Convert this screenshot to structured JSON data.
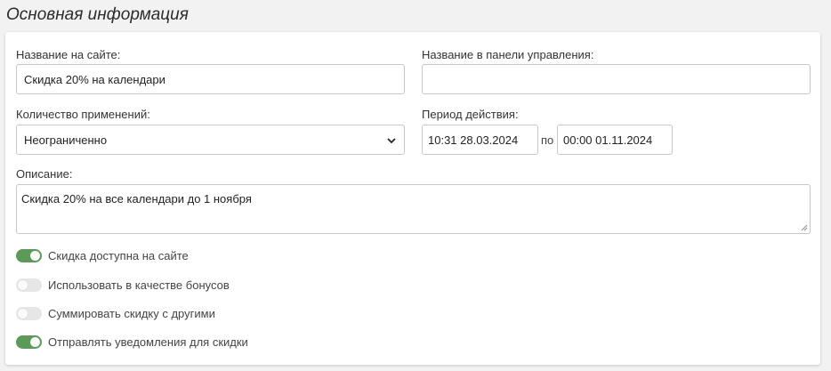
{
  "section_title": "Основная информация",
  "fields": {
    "site_name": {
      "label": "Название на сайте:",
      "value": "Скидка 20% на календари"
    },
    "admin_name": {
      "label": "Название в панели управления:",
      "value": ""
    },
    "usage_count": {
      "label": "Количество применений:",
      "selected": "Неограниченно"
    },
    "period": {
      "label": "Период действия:",
      "from": "10:31 28.03.2024",
      "separator": "по",
      "to": "00:00 01.11.2024"
    },
    "description": {
      "label": "Описание:",
      "value": "Скидка 20% на все календари до 1 ноября"
    }
  },
  "toggles": [
    {
      "label": "Скидка доступна на сайте",
      "on": true
    },
    {
      "label": "Использовать в качестве бонусов",
      "on": false
    },
    {
      "label": "Суммировать скидку с другими",
      "on": false
    },
    {
      "label": "Отправлять уведомления для скидки",
      "on": true
    }
  ],
  "colors": {
    "toggle_on": "#5b9a59",
    "toggle_off": "#e6e6e6"
  },
  "icons": {
    "select": "chevron-down-icon",
    "textarea": "resize-grip-icon"
  }
}
